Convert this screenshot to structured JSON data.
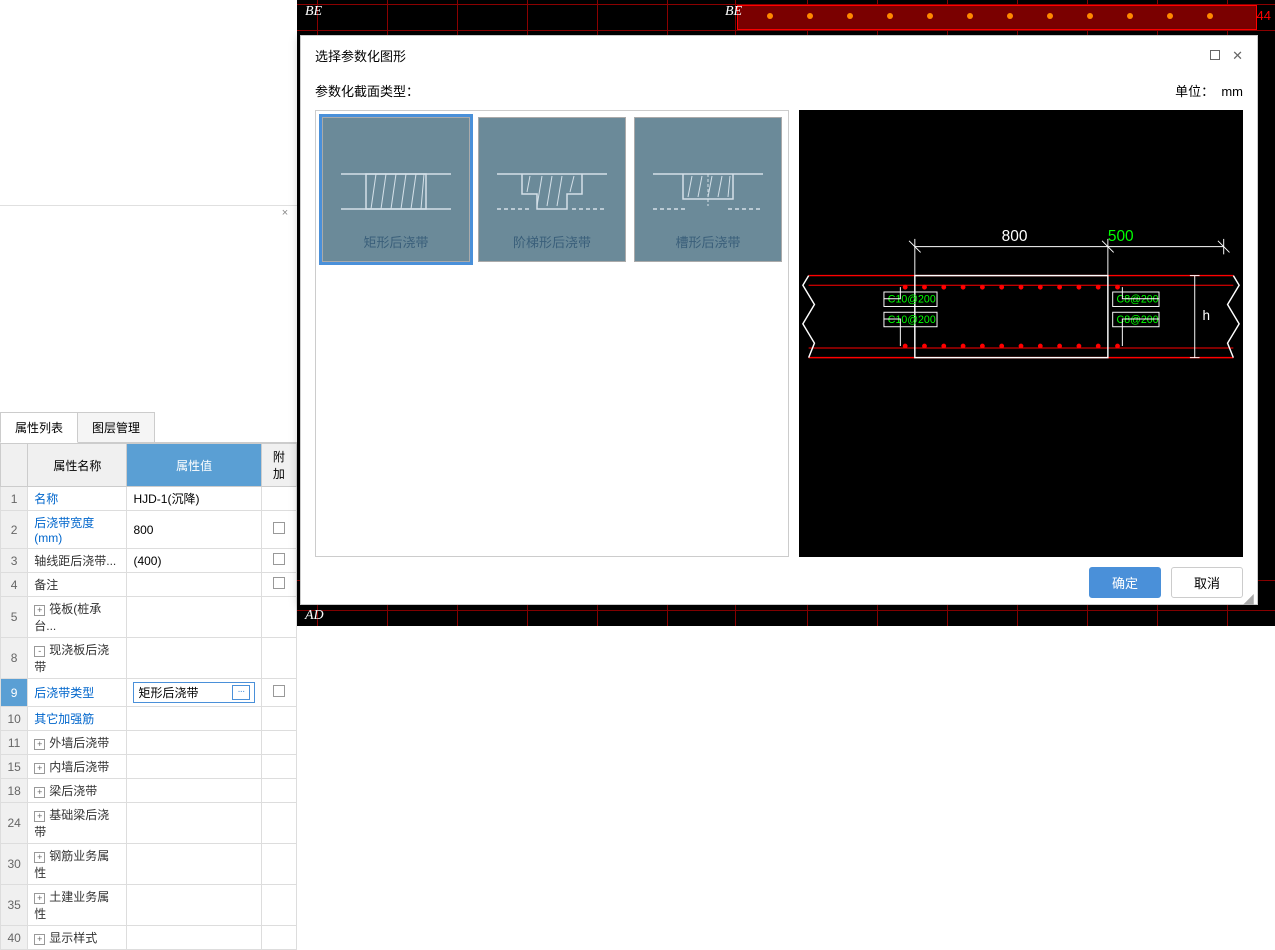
{
  "tabs": {
    "prop": "属性列表",
    "layer": "图层管理"
  },
  "cols": {
    "name": "属性名称",
    "val": "属性值",
    "add": "附加"
  },
  "rows": [
    {
      "n": "1",
      "name": "名称",
      "val": "HJD-1(沉降)",
      "link": true,
      "chk": false
    },
    {
      "n": "2",
      "name": "后浇带宽度(mm)",
      "val": "800",
      "link": true,
      "chk": true
    },
    {
      "n": "3",
      "name": "轴线距后浇带...",
      "val": "(400)",
      "link": false,
      "chk": true
    },
    {
      "n": "4",
      "name": "备注",
      "val": "",
      "link": false,
      "chk": true
    },
    {
      "n": "5",
      "name": "筏板(桩承台...",
      "val": "",
      "tree": "+",
      "link": false
    },
    {
      "n": "8",
      "name": "现浇板后浇带",
      "val": "",
      "tree": "-",
      "link": false
    },
    {
      "n": "9",
      "name": "后浇带类型",
      "val": "矩形后浇带",
      "indent": true,
      "link": true,
      "chk": true,
      "editing": true,
      "active": true
    },
    {
      "n": "10",
      "name": "其它加强筋",
      "val": "",
      "indent": true,
      "link": true
    },
    {
      "n": "11",
      "name": "外墙后浇带",
      "val": "",
      "tree": "+",
      "link": false
    },
    {
      "n": "15",
      "name": "内墙后浇带",
      "val": "",
      "tree": "+",
      "link": false
    },
    {
      "n": "18",
      "name": "梁后浇带",
      "val": "",
      "tree": "+",
      "link": false
    },
    {
      "n": "24",
      "name": "基础梁后浇带",
      "val": "",
      "tree": "+",
      "link": false
    },
    {
      "n": "30",
      "name": "钢筋业务属性",
      "val": "",
      "tree": "+",
      "link": false
    },
    {
      "n": "35",
      "name": "土建业务属性",
      "val": "",
      "tree": "+",
      "link": false
    },
    {
      "n": "40",
      "name": "显示样式",
      "val": "",
      "tree": "+",
      "link": false
    }
  ],
  "cad": {
    "be1": "BE",
    "be2": "BE",
    "ad": "AD"
  },
  "dialog": {
    "title": "选择参数化图形",
    "subtitle": "参数化截面类型：",
    "unit_label": "单位：",
    "unit_val": "mm",
    "shapes": [
      {
        "label": "矩形后浇带",
        "selected": true
      },
      {
        "label": "阶梯形后浇带",
        "selected": false
      },
      {
        "label": "槽形后浇带",
        "selected": false
      }
    ],
    "preview": {
      "dim800": "800",
      "dim500": "500",
      "h": "h",
      "rebar_top_left": "C10@200",
      "rebar_top_right": "C8@200",
      "rebar_bot_left": "C10@200",
      "rebar_bot_right": "C8@200"
    },
    "ok": "确定",
    "cancel": "取消"
  }
}
